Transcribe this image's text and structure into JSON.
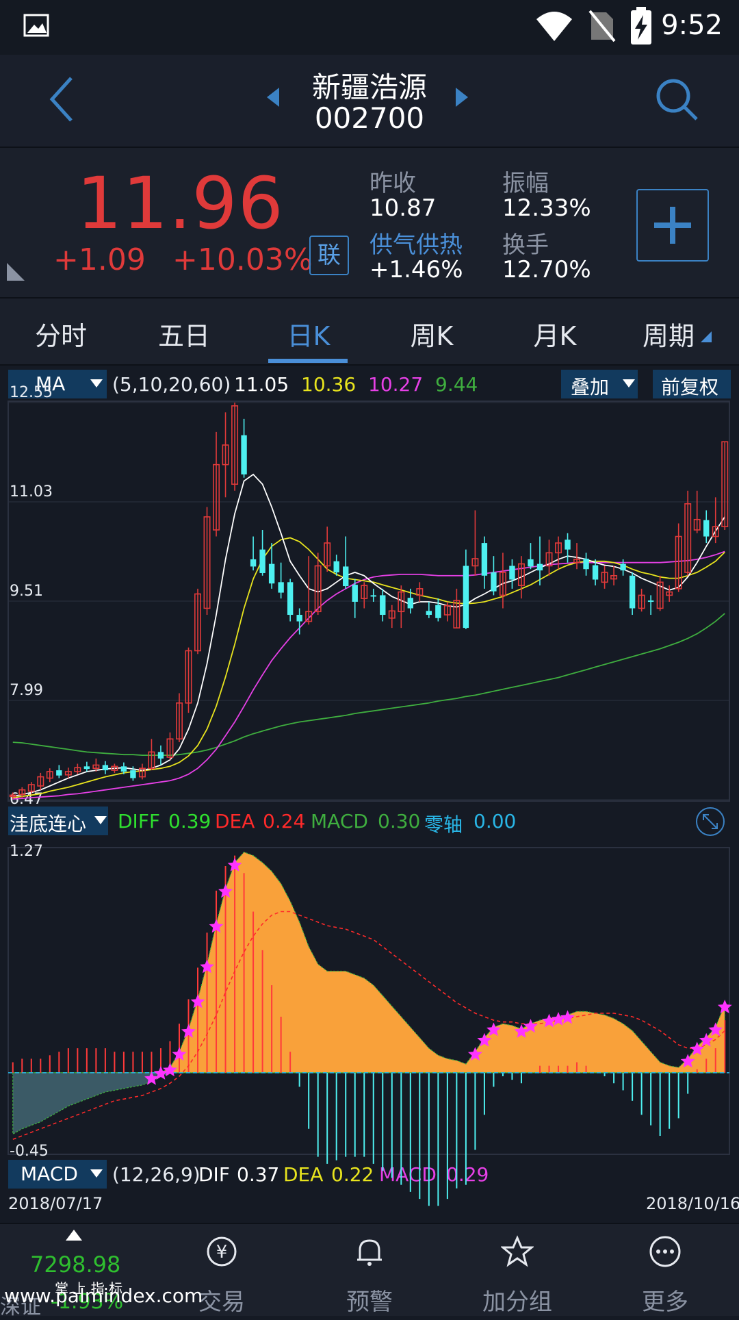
{
  "status_bar": {
    "time": "9:52"
  },
  "header": {
    "stock_name": "新疆浩源",
    "stock_code": "002700"
  },
  "quote": {
    "price": "11.96",
    "change": "+1.09",
    "change_pct": "+10.03%",
    "lian_badge": "联",
    "prev_close_label": "昨收",
    "prev_close": "10.87",
    "amplitude_label": "振幅",
    "amplitude": "12.33%",
    "sector_label": "供气供热",
    "sector_change": "+1.46%",
    "turnover_label": "换手",
    "turnover": "12.70%"
  },
  "tabs": [
    {
      "label": "分时"
    },
    {
      "label": "五日"
    },
    {
      "label": "日K",
      "active": true
    },
    {
      "label": "周K"
    },
    {
      "label": "月K"
    },
    {
      "label": "周期"
    }
  ],
  "ma_bar": {
    "selector": "MA",
    "params": "(5,10,20,60)",
    "values": [
      "11.05",
      "10.36",
      "10.27",
      "9.44"
    ],
    "overlay": "叠加",
    "adjust": "前复权"
  },
  "colors": {
    "up": "#e03a3a",
    "down": "#4ef0f0",
    "ma5": "#ffffff",
    "ma10": "#e8e41e",
    "ma20": "#e640e6",
    "ma60": "#3fae3f",
    "macd_area": "#f9a13a",
    "star": "#ff33ff",
    "accent": "#4a8fd8"
  },
  "price_axis": {
    "labels": [
      "12.55",
      "11.03",
      "9.51",
      "7.99",
      "6.47"
    ]
  },
  "indicator_bar": {
    "selector": "洼底连心",
    "diff_label": "DIFF",
    "diff": "0.39",
    "dea_label": "DEA",
    "dea": "0.24",
    "macd_label": "MACD",
    "macd": "0.30",
    "zero_label": "零轴",
    "zero": "0.00"
  },
  "macd_axis": {
    "labels": [
      "1.27",
      "-0.45"
    ]
  },
  "macd_bar": {
    "selector": "MACD",
    "params": "(12,26,9)",
    "dif_label": "DIF",
    "dif": "0.37",
    "dea_label": "DEA",
    "dea": "0.22",
    "macd_label": "MACD",
    "macd": "0.29"
  },
  "date_range": {
    "start": "2018/07/17",
    "end": "2018/10/16"
  },
  "nav": {
    "index_value": "7298.98",
    "index_label": "深证",
    "index_change": "-1.93%",
    "brand_label": "掌 上 指 标",
    "items": [
      {
        "label": "交易"
      },
      {
        "label": "预警"
      },
      {
        "label": "加分组"
      },
      {
        "label": "更多"
      }
    ]
  },
  "watermark": "www.palmindex.com",
  "chart_data": {
    "type": "candlestick",
    "title": "",
    "x_range": [
      "2018/07/17",
      "2018/10/16"
    ],
    "ylim": [
      6.47,
      12.55
    ],
    "candles": [
      [
        6.52,
        6.54,
        6.48,
        6.58
      ],
      [
        6.55,
        6.62,
        6.5,
        6.66
      ],
      [
        6.6,
        6.7,
        6.56,
        6.74
      ],
      [
        6.68,
        6.82,
        6.62,
        6.88
      ],
      [
        6.8,
        6.9,
        6.74,
        6.95
      ],
      [
        6.92,
        6.84,
        6.8,
        7.0
      ],
      [
        6.85,
        6.9,
        6.8,
        6.96
      ],
      [
        6.9,
        6.96,
        6.86,
        7.02
      ],
      [
        6.98,
        6.94,
        6.9,
        7.05
      ],
      [
        6.95,
        7.0,
        6.9,
        7.1
      ],
      [
        7.0,
        6.92,
        6.86,
        7.06
      ],
      [
        6.92,
        6.98,
        6.88,
        7.02
      ],
      [
        6.98,
        6.9,
        6.86,
        7.04
      ],
      [
        6.92,
        6.8,
        6.76,
        6.98
      ],
      [
        6.82,
        6.95,
        6.78,
        7.02
      ],
      [
        6.95,
        7.2,
        6.92,
        7.4
      ],
      [
        7.2,
        7.1,
        7.0,
        7.3
      ],
      [
        7.12,
        7.4,
        7.08,
        7.5
      ],
      [
        7.4,
        7.95,
        7.35,
        8.1
      ],
      [
        7.95,
        8.75,
        7.8,
        8.8
      ],
      [
        8.75,
        9.62,
        8.7,
        9.7
      ],
      [
        9.4,
        10.8,
        9.3,
        10.95
      ],
      [
        10.6,
        11.6,
        10.5,
        12.1
      ],
      [
        11.6,
        11.9,
        11.1,
        12.4
      ],
      [
        11.3,
        12.5,
        11.2,
        12.55
      ],
      [
        12.05,
        11.45,
        11.4,
        12.3
      ],
      [
        10.15,
        10.04,
        9.98,
        10.5
      ],
      [
        10.3,
        9.94,
        9.9,
        10.6
      ],
      [
        10.08,
        9.78,
        9.7,
        10.4
      ],
      [
        9.8,
        9.64,
        9.55,
        10.1
      ],
      [
        9.8,
        9.3,
        9.2,
        9.85
      ],
      [
        9.3,
        9.2,
        9.0,
        9.4
      ],
      [
        9.2,
        9.35,
        9.15,
        10.2
      ],
      [
        9.35,
        10.05,
        9.3,
        10.25
      ],
      [
        10.05,
        10.4,
        9.96,
        10.65
      ],
      [
        10.12,
        9.95,
        9.9,
        10.22
      ],
      [
        10.04,
        9.74,
        9.7,
        10.5
      ],
      [
        9.76,
        9.5,
        9.25,
        9.85
      ],
      [
        9.55,
        9.75,
        9.4,
        9.8
      ],
      [
        9.6,
        9.58,
        9.5,
        9.7
      ],
      [
        9.6,
        9.3,
        9.2,
        9.7
      ],
      [
        9.25,
        9.36,
        9.1,
        9.45
      ],
      [
        9.35,
        9.65,
        9.1,
        9.75
      ],
      [
        9.56,
        9.4,
        9.32,
        9.7
      ],
      [
        9.6,
        9.7,
        9.5,
        9.8
      ],
      [
        9.36,
        9.3,
        9.25,
        9.5
      ],
      [
        9.45,
        9.25,
        9.2,
        9.55
      ],
      [
        9.3,
        9.44,
        9.2,
        9.5
      ],
      [
        9.1,
        9.52,
        9.1,
        9.7
      ],
      [
        10.05,
        9.1,
        9.08,
        10.3
      ],
      [
        10.05,
        10.16,
        9.9,
        10.9
      ],
      [
        10.4,
        9.9,
        9.7,
        10.5
      ],
      [
        9.95,
        9.66,
        9.6,
        10.2
      ],
      [
        9.6,
        9.95,
        9.4,
        10.25
      ],
      [
        10.05,
        9.84,
        9.7,
        10.15
      ],
      [
        9.75,
        10.08,
        9.55,
        10.2
      ],
      [
        10.15,
        10.04,
        10.0,
        10.4
      ],
      [
        10.08,
        9.98,
        9.75,
        10.5
      ],
      [
        10.05,
        10.25,
        9.9,
        10.45
      ],
      [
        10.25,
        10.4,
        10.0,
        10.5
      ],
      [
        10.45,
        10.3,
        10.1,
        10.55
      ],
      [
        10.1,
        10.15,
        10.0,
        10.4
      ],
      [
        10.16,
        10.0,
        9.9,
        10.25
      ],
      [
        10.06,
        9.84,
        9.75,
        10.15
      ],
      [
        9.8,
        9.95,
        9.7,
        10.05
      ],
      [
        9.85,
        9.9,
        9.75,
        10.05
      ],
      [
        10.08,
        9.98,
        9.9,
        10.15
      ],
      [
        9.9,
        9.4,
        9.3,
        9.95
      ],
      [
        9.4,
        9.6,
        9.35,
        9.7
      ],
      [
        9.52,
        9.5,
        9.3,
        9.6
      ],
      [
        9.4,
        9.8,
        9.36,
        9.9
      ],
      [
        9.6,
        9.65,
        9.5,
        9.75
      ],
      [
        9.7,
        10.5,
        9.65,
        10.7
      ],
      [
        9.95,
        11.0,
        9.9,
        11.2
      ],
      [
        10.6,
        10.76,
        10.55,
        11.2
      ],
      [
        10.75,
        10.5,
        10.4,
        10.9
      ],
      [
        10.5,
        10.65,
        10.4,
        11.1
      ],
      [
        10.65,
        11.95,
        10.6,
        11.95
      ]
    ],
    "ma5": [
      6.52,
      6.55,
      6.58,
      6.62,
      6.68,
      6.74,
      6.8,
      6.85,
      6.9,
      6.92,
      6.94,
      6.95,
      6.96,
      6.94,
      6.92,
      6.95,
      7.0,
      7.08,
      7.25,
      7.55,
      7.95,
      8.55,
      9.3,
      10.15,
      10.85,
      11.35,
      11.45,
      11.3,
      10.95,
      10.55,
      10.12,
      9.9,
      9.7,
      9.65,
      9.7,
      9.8,
      9.9,
      9.95,
      9.9,
      9.78,
      9.68,
      9.58,
      9.52,
      9.46,
      9.5,
      9.5,
      9.48,
      9.44,
      9.42,
      9.46,
      9.55,
      9.62,
      9.7,
      9.78,
      9.82,
      9.88,
      9.95,
      10.02,
      10.08,
      10.15,
      10.2,
      10.18,
      10.15,
      10.1,
      10.06,
      10.04,
      10.0,
      9.94,
      9.86,
      9.8,
      9.74,
      9.68,
      9.72,
      9.88,
      10.1,
      10.35,
      10.58,
      10.8
    ],
    "ma10": [
      6.5,
      6.52,
      6.54,
      6.56,
      6.6,
      6.63,
      6.66,
      6.7,
      6.74,
      6.78,
      6.82,
      6.85,
      6.88,
      6.9,
      6.91,
      6.93,
      6.95,
      6.98,
      7.04,
      7.14,
      7.3,
      7.55,
      7.9,
      8.35,
      8.85,
      9.4,
      9.85,
      10.15,
      10.35,
      10.45,
      10.48,
      10.42,
      10.3,
      10.15,
      10.0,
      9.92,
      9.86,
      9.84,
      9.82,
      9.8,
      9.76,
      9.72,
      9.68,
      9.64,
      9.6,
      9.57,
      9.54,
      9.5,
      9.48,
      9.47,
      9.48,
      9.5,
      9.54,
      9.58,
      9.64,
      9.7,
      9.76,
      9.84,
      9.92,
      10.0,
      10.06,
      10.1,
      10.12,
      10.12,
      10.12,
      10.1,
      10.06,
      10.0,
      9.95,
      9.92,
      9.88,
      9.86,
      9.86,
      9.9,
      9.95,
      10.03,
      10.12,
      10.26
    ],
    "ma20": [
      6.48,
      6.49,
      6.5,
      6.51,
      6.52,
      6.53,
      6.55,
      6.56,
      6.58,
      6.6,
      6.62,
      6.64,
      6.66,
      6.68,
      6.7,
      6.72,
      6.74,
      6.76,
      6.8,
      6.86,
      6.95,
      7.08,
      7.24,
      7.45,
      7.66,
      7.9,
      8.15,
      8.38,
      8.6,
      8.78,
      8.95,
      9.1,
      9.25,
      9.4,
      9.52,
      9.62,
      9.7,
      9.78,
      9.84,
      9.88,
      9.9,
      9.91,
      9.92,
      9.92,
      9.92,
      9.91,
      9.9,
      9.9,
      9.9,
      9.9,
      9.91,
      9.93,
      9.95,
      9.97,
      9.99,
      10.01,
      10.03,
      10.05,
      10.07,
      10.08,
      10.09,
      10.1,
      10.1,
      10.1,
      10.1,
      10.1,
      10.1,
      10.1,
      10.1,
      10.1,
      10.1,
      10.11,
      10.12,
      10.13,
      10.15,
      10.18,
      10.22,
      10.27
    ],
    "ma60": [
      7.35,
      7.34,
      7.32,
      7.3,
      7.28,
      7.26,
      7.24,
      7.22,
      7.2,
      7.19,
      7.18,
      7.17,
      7.16,
      7.16,
      7.15,
      7.15,
      7.15,
      7.15,
      7.16,
      7.18,
      7.2,
      7.23,
      7.27,
      7.32,
      7.37,
      7.43,
      7.48,
      7.52,
      7.56,
      7.6,
      7.63,
      7.66,
      7.68,
      7.7,
      7.72,
      7.74,
      7.76,
      7.79,
      7.81,
      7.83,
      7.85,
      7.87,
      7.89,
      7.91,
      7.93,
      7.95,
      7.98,
      8.0,
      8.02,
      8.05,
      8.07,
      8.1,
      8.13,
      8.16,
      8.19,
      8.22,
      8.25,
      8.28,
      8.31,
      8.34,
      8.38,
      8.42,
      8.46,
      8.5,
      8.54,
      8.58,
      8.62,
      8.66,
      8.7,
      8.74,
      8.78,
      8.83,
      8.88,
      8.94,
      9.01,
      9.1,
      9.2,
      9.32
    ],
    "macd_area_dif": [
      -0.35,
      -0.32,
      -0.3,
      -0.28,
      -0.25,
      -0.22,
      -0.19,
      -0.17,
      -0.15,
      -0.13,
      -0.11,
      -0.1,
      -0.09,
      -0.08,
      -0.07,
      -0.05,
      -0.02,
      0.03,
      0.12,
      0.25,
      0.42,
      0.62,
      0.85,
      1.05,
      1.2,
      1.26,
      1.24,
      1.2,
      1.15,
      1.08,
      0.98,
      0.86,
      0.72,
      0.62,
      0.58,
      0.58,
      0.58,
      0.56,
      0.54,
      0.5,
      0.44,
      0.38,
      0.32,
      0.26,
      0.2,
      0.14,
      0.1,
      0.08,
      0.07,
      0.05,
      0.12,
      0.2,
      0.26,
      0.28,
      0.27,
      0.25,
      0.28,
      0.3,
      0.31,
      0.32,
      0.33,
      0.35,
      0.35,
      0.34,
      0.33,
      0.31,
      0.28,
      0.24,
      0.18,
      0.12,
      0.06,
      0.04,
      0.03,
      0.08,
      0.15,
      0.2,
      0.26,
      0.39
    ],
    "macd_dea": [
      -0.38,
      -0.36,
      -0.34,
      -0.32,
      -0.3,
      -0.28,
      -0.26,
      -0.24,
      -0.22,
      -0.2,
      -0.18,
      -0.16,
      -0.15,
      -0.14,
      -0.13,
      -0.11,
      -0.09,
      -0.06,
      -0.02,
      0.04,
      0.12,
      0.22,
      0.33,
      0.46,
      0.58,
      0.69,
      0.78,
      0.85,
      0.9,
      0.92,
      0.92,
      0.9,
      0.88,
      0.86,
      0.84,
      0.83,
      0.82,
      0.8,
      0.78,
      0.76,
      0.72,
      0.68,
      0.64,
      0.6,
      0.56,
      0.52,
      0.48,
      0.44,
      0.4,
      0.37,
      0.34,
      0.32,
      0.3,
      0.29,
      0.29,
      0.28,
      0.28,
      0.28,
      0.29,
      0.3,
      0.31,
      0.32,
      0.33,
      0.34,
      0.34,
      0.34,
      0.33,
      0.32,
      0.3,
      0.27,
      0.24,
      0.2,
      0.16,
      0.14,
      0.14,
      0.16,
      0.19,
      0.24
    ],
    "macd_ylim": [
      -0.45,
      1.27
    ]
  }
}
